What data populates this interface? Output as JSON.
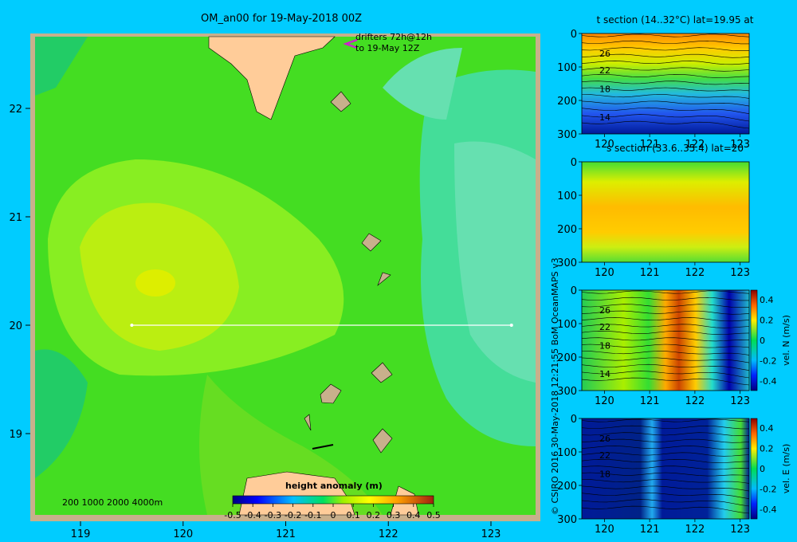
{
  "main_map": {
    "title": "OM_an00 for 19-May-2018 00Z",
    "drifters_label_1": "drifters 72h@12h",
    "drifters_label_2": "to 19-May 12Z",
    "depth_scale": "200  1000  2000  4000m",
    "x_ticks": [
      "119",
      "120",
      "121",
      "122",
      "123"
    ],
    "y_ticks": [
      "22",
      "21",
      "20",
      "19"
    ],
    "section_line_lat": 20,
    "section_line_lon": [
      119.5,
      123.2
    ],
    "colorbar": {
      "title": "height anomaly (m)",
      "ticks": [
        "-0.5",
        "-0.4",
        "-0.3",
        "-0.2",
        "-0.1",
        "0",
        "0.1",
        "0.2",
        "0.3",
        "0.4",
        "0.5"
      ]
    }
  },
  "credit": "© CSIRO 2016   30-May-2018 12:21:55 BoM OceanMAPS v3",
  "panels": [
    {
      "title": "t section (14..32°C) lat=19.95 at",
      "contour_labels": [
        "26",
        "22",
        "18",
        "14"
      ],
      "colorbar": null
    },
    {
      "title": "s section (33.6..35.4) lat=20",
      "contour_labels": [],
      "colorbar": null
    },
    {
      "title": "",
      "contour_labels": [
        "26",
        "22",
        "18",
        "14"
      ],
      "colorbar": {
        "label": "vel. N (m/s)",
        "ticks": [
          "0.4",
          "0.2",
          "0",
          "-0.2",
          "-0.4"
        ]
      }
    },
    {
      "title": "",
      "contour_labels": [
        "26",
        "22",
        "18"
      ],
      "colorbar": {
        "label": "vel. E (m/s)",
        "ticks": [
          "0.4",
          "0.2",
          "0",
          "-0.2",
          "-0.4"
        ]
      }
    }
  ],
  "panel_axes": {
    "x_ticks": [
      "120",
      "121",
      "122",
      "123"
    ],
    "y_ticks": [
      "0",
      "100",
      "200",
      "300"
    ]
  },
  "chart_data": [
    {
      "type": "heatmap",
      "title": "OM_an00 for 19-May-2018 00Z",
      "xlabel": "",
      "ylabel": "",
      "xlim": [
        118.5,
        123.5
      ],
      "ylim": [
        18.3,
        22.7
      ],
      "colorbar_label": "height anomaly (m)",
      "colorbar_range": [
        -0.5,
        0.5
      ],
      "features": {
        "section_line": {
          "lat": 20,
          "lon_start": 119.5,
          "lon_end": 123.2
        }
      }
    },
    {
      "type": "heatmap",
      "title": "t section (14..32°C) lat=19.95 at",
      "x_ticks": [
        120,
        121,
        122,
        123
      ],
      "y_ticks": [
        0,
        100,
        200,
        300
      ],
      "xlim": [
        119.5,
        123.2
      ],
      "ylim": [
        300,
        0
      ],
      "contour_labels": [
        26,
        22,
        18,
        14
      ]
    },
    {
      "type": "heatmap",
      "title": "s section (33.6..35.4) lat=20",
      "x_ticks": [
        120,
        121,
        122,
        123
      ],
      "y_ticks": [
        0,
        100,
        200,
        300
      ],
      "xlim": [
        119.5,
        123.2
      ],
      "ylim": [
        300,
        0
      ]
    },
    {
      "type": "heatmap",
      "title": "",
      "x_ticks": [
        120,
        121,
        122,
        123
      ],
      "y_ticks": [
        0,
        100,
        200,
        300
      ],
      "xlim": [
        119.5,
        123.2
      ],
      "ylim": [
        300,
        0
      ],
      "colorbar_label": "vel. N (m/s)",
      "colorbar_range": [
        -0.4,
        0.4
      ],
      "contour_labels": [
        26,
        22,
        18,
        14
      ]
    },
    {
      "type": "heatmap",
      "title": "",
      "x_ticks": [
        120,
        121,
        122,
        123
      ],
      "y_ticks": [
        0,
        100,
        200,
        300
      ],
      "xlim": [
        119.5,
        123.2
      ],
      "ylim": [
        300,
        0
      ],
      "colorbar_label": "vel. E (m/s)",
      "colorbar_range": [
        -0.4,
        0.4
      ],
      "contour_labels": [
        26,
        22,
        18
      ]
    }
  ]
}
